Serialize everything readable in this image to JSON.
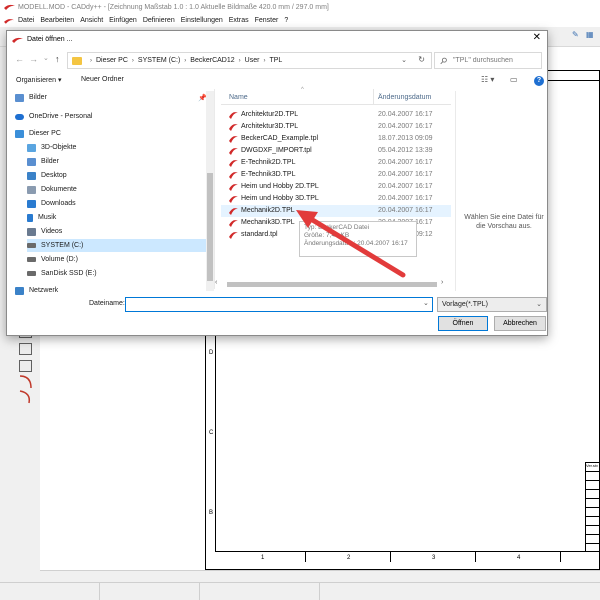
{
  "app": {
    "title": "MODELL.MOD  -  CADdy++ - [Zeichnung    Maßstab 1.0 : 1.0   Aktuelle Bildmaße 420.0 mm / 297.0 mm]",
    "menu": [
      "Datei",
      "Bearbeiten",
      "Ansicht",
      "Einfügen",
      "Definieren",
      "Einstellungen",
      "Extras",
      "Fenster",
      "?"
    ],
    "row_letters": [
      "D",
      "C",
      "B"
    ],
    "column_numbers": [
      "1",
      "2",
      "3",
      "4"
    ],
    "title_block_label": "Ver.stv"
  },
  "dialog": {
    "title": "Datei öffnen ...",
    "close": "✕",
    "nav": {
      "back": "←",
      "forward": "→",
      "recent": "⌄",
      "up": "↑"
    },
    "breadcrumb": [
      "Dieser PC",
      "SYSTEM (C:)",
      "BeckerCAD12",
      "User",
      "TPL"
    ],
    "breadcrumb_sep": "›",
    "search_placeholder": "\"TPL\" durchsuchen",
    "organize": "Organisieren ▾",
    "new_folder": "Neuer Ordner",
    "help": "?",
    "navigation_pane": [
      {
        "label": "Bilder",
        "icon": "pictures-icon",
        "color": "#5a8fd0"
      },
      {
        "label": "OneDrive - Personal",
        "icon": "onedrive-icon",
        "color": "#1e6fd1"
      },
      {
        "label": "Dieser PC",
        "icon": "computer-icon",
        "color": "#3b8fd9"
      },
      {
        "label": "3D-Objekte",
        "icon": "3d-objects-icon",
        "color": "#5aa5e0"
      },
      {
        "label": "Bilder",
        "icon": "pictures-icon",
        "color": "#5a8fd0"
      },
      {
        "label": "Desktop",
        "icon": "desktop-icon",
        "color": "#3b82c8"
      },
      {
        "label": "Dokumente",
        "icon": "documents-icon",
        "color": "#8a9bb0"
      },
      {
        "label": "Downloads",
        "icon": "downloads-icon",
        "color": "#2a7bd0"
      },
      {
        "label": "Musik",
        "icon": "music-icon",
        "color": "#2a7bd0"
      },
      {
        "label": "Videos",
        "icon": "videos-icon",
        "color": "#6a7a90"
      },
      {
        "label": "SYSTEM (C:)",
        "icon": "drive-icon",
        "color": "#6a6a6a"
      },
      {
        "label": "Volume (D:)",
        "icon": "drive-icon",
        "color": "#6a6a6a"
      },
      {
        "label": "SanDisk SSD (E:)",
        "icon": "drive-icon",
        "color": "#6a6a6a"
      },
      {
        "label": "Netzwerk",
        "icon": "network-icon",
        "color": "#3b82c8"
      }
    ],
    "columns": {
      "name": "Name",
      "date": "Änderungsdatum"
    },
    "files": [
      {
        "name": "Architektur2D.TPL",
        "date": "20.04.2007 16:17"
      },
      {
        "name": "Architektur3D.TPL",
        "date": "20.04.2007 16:17"
      },
      {
        "name": "BeckerCAD_Example.tpl",
        "date": "18.07.2013 09:09"
      },
      {
        "name": "DWGDXF_IMPORT.tpl",
        "date": "05.04.2012 13:39"
      },
      {
        "name": "E-Technik2D.TPL",
        "date": "20.04.2007 16:17"
      },
      {
        "name": "E-Technik3D.TPL",
        "date": "20.04.2007 16:17"
      },
      {
        "name": "Heim und Hobby 2D.TPL",
        "date": "20.04.2007 16:17"
      },
      {
        "name": "Heim und Hobby 3D.TPL",
        "date": "20.04.2007 16:17"
      },
      {
        "name": "Mechanik2D.TPL",
        "date": "20.04.2007 16:17"
      },
      {
        "name": "Mechanik3D.TPL",
        "date": "20.04.2007 16:17"
      },
      {
        "name": "standard.tpl",
        "date": "03.07.2019 09:12"
      }
    ],
    "tooltip": [
      "Typ: BeckerCAD Datei",
      "Größe: 7,42 KB",
      "Änderungsdatum: 20.04.2007 16:17"
    ],
    "preview_text": "Wählen Sie eine Datei für die Vorschau aus.",
    "filename_label": "Dateiname:",
    "filename_value": "",
    "filetype": "Vorlage(*.TPL)",
    "open_button": "Öffnen",
    "cancel_button": "Abbrechen"
  },
  "colors": {
    "accent": "#0078d7",
    "selection": "#cce8ff",
    "hover": "#e5f3ff",
    "arrow": "#e23b3b",
    "file_icon": "#d12a2a"
  }
}
